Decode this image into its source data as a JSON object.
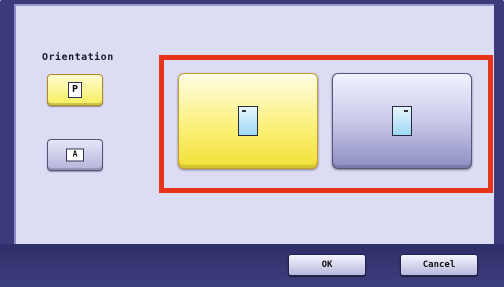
{
  "orientation": {
    "label": "Orientation",
    "portrait_glyph": "P",
    "landscape_glyph": "A",
    "selected": "portrait"
  },
  "icons": {
    "portrait_small": "portrait-page-icon",
    "landscape_small": "landscape-page-icon",
    "portrait_large": "portrait-document-icon",
    "landscape_large": "landscape-document-icon"
  },
  "footer": {
    "ok_label": "OK",
    "cancel_label": "Cancel"
  },
  "colors": {
    "selected_button": "#f6ee5c",
    "highlight_box": "#e8321a",
    "panel_background": "#dcdcf4",
    "frame": "#3a3b78"
  }
}
